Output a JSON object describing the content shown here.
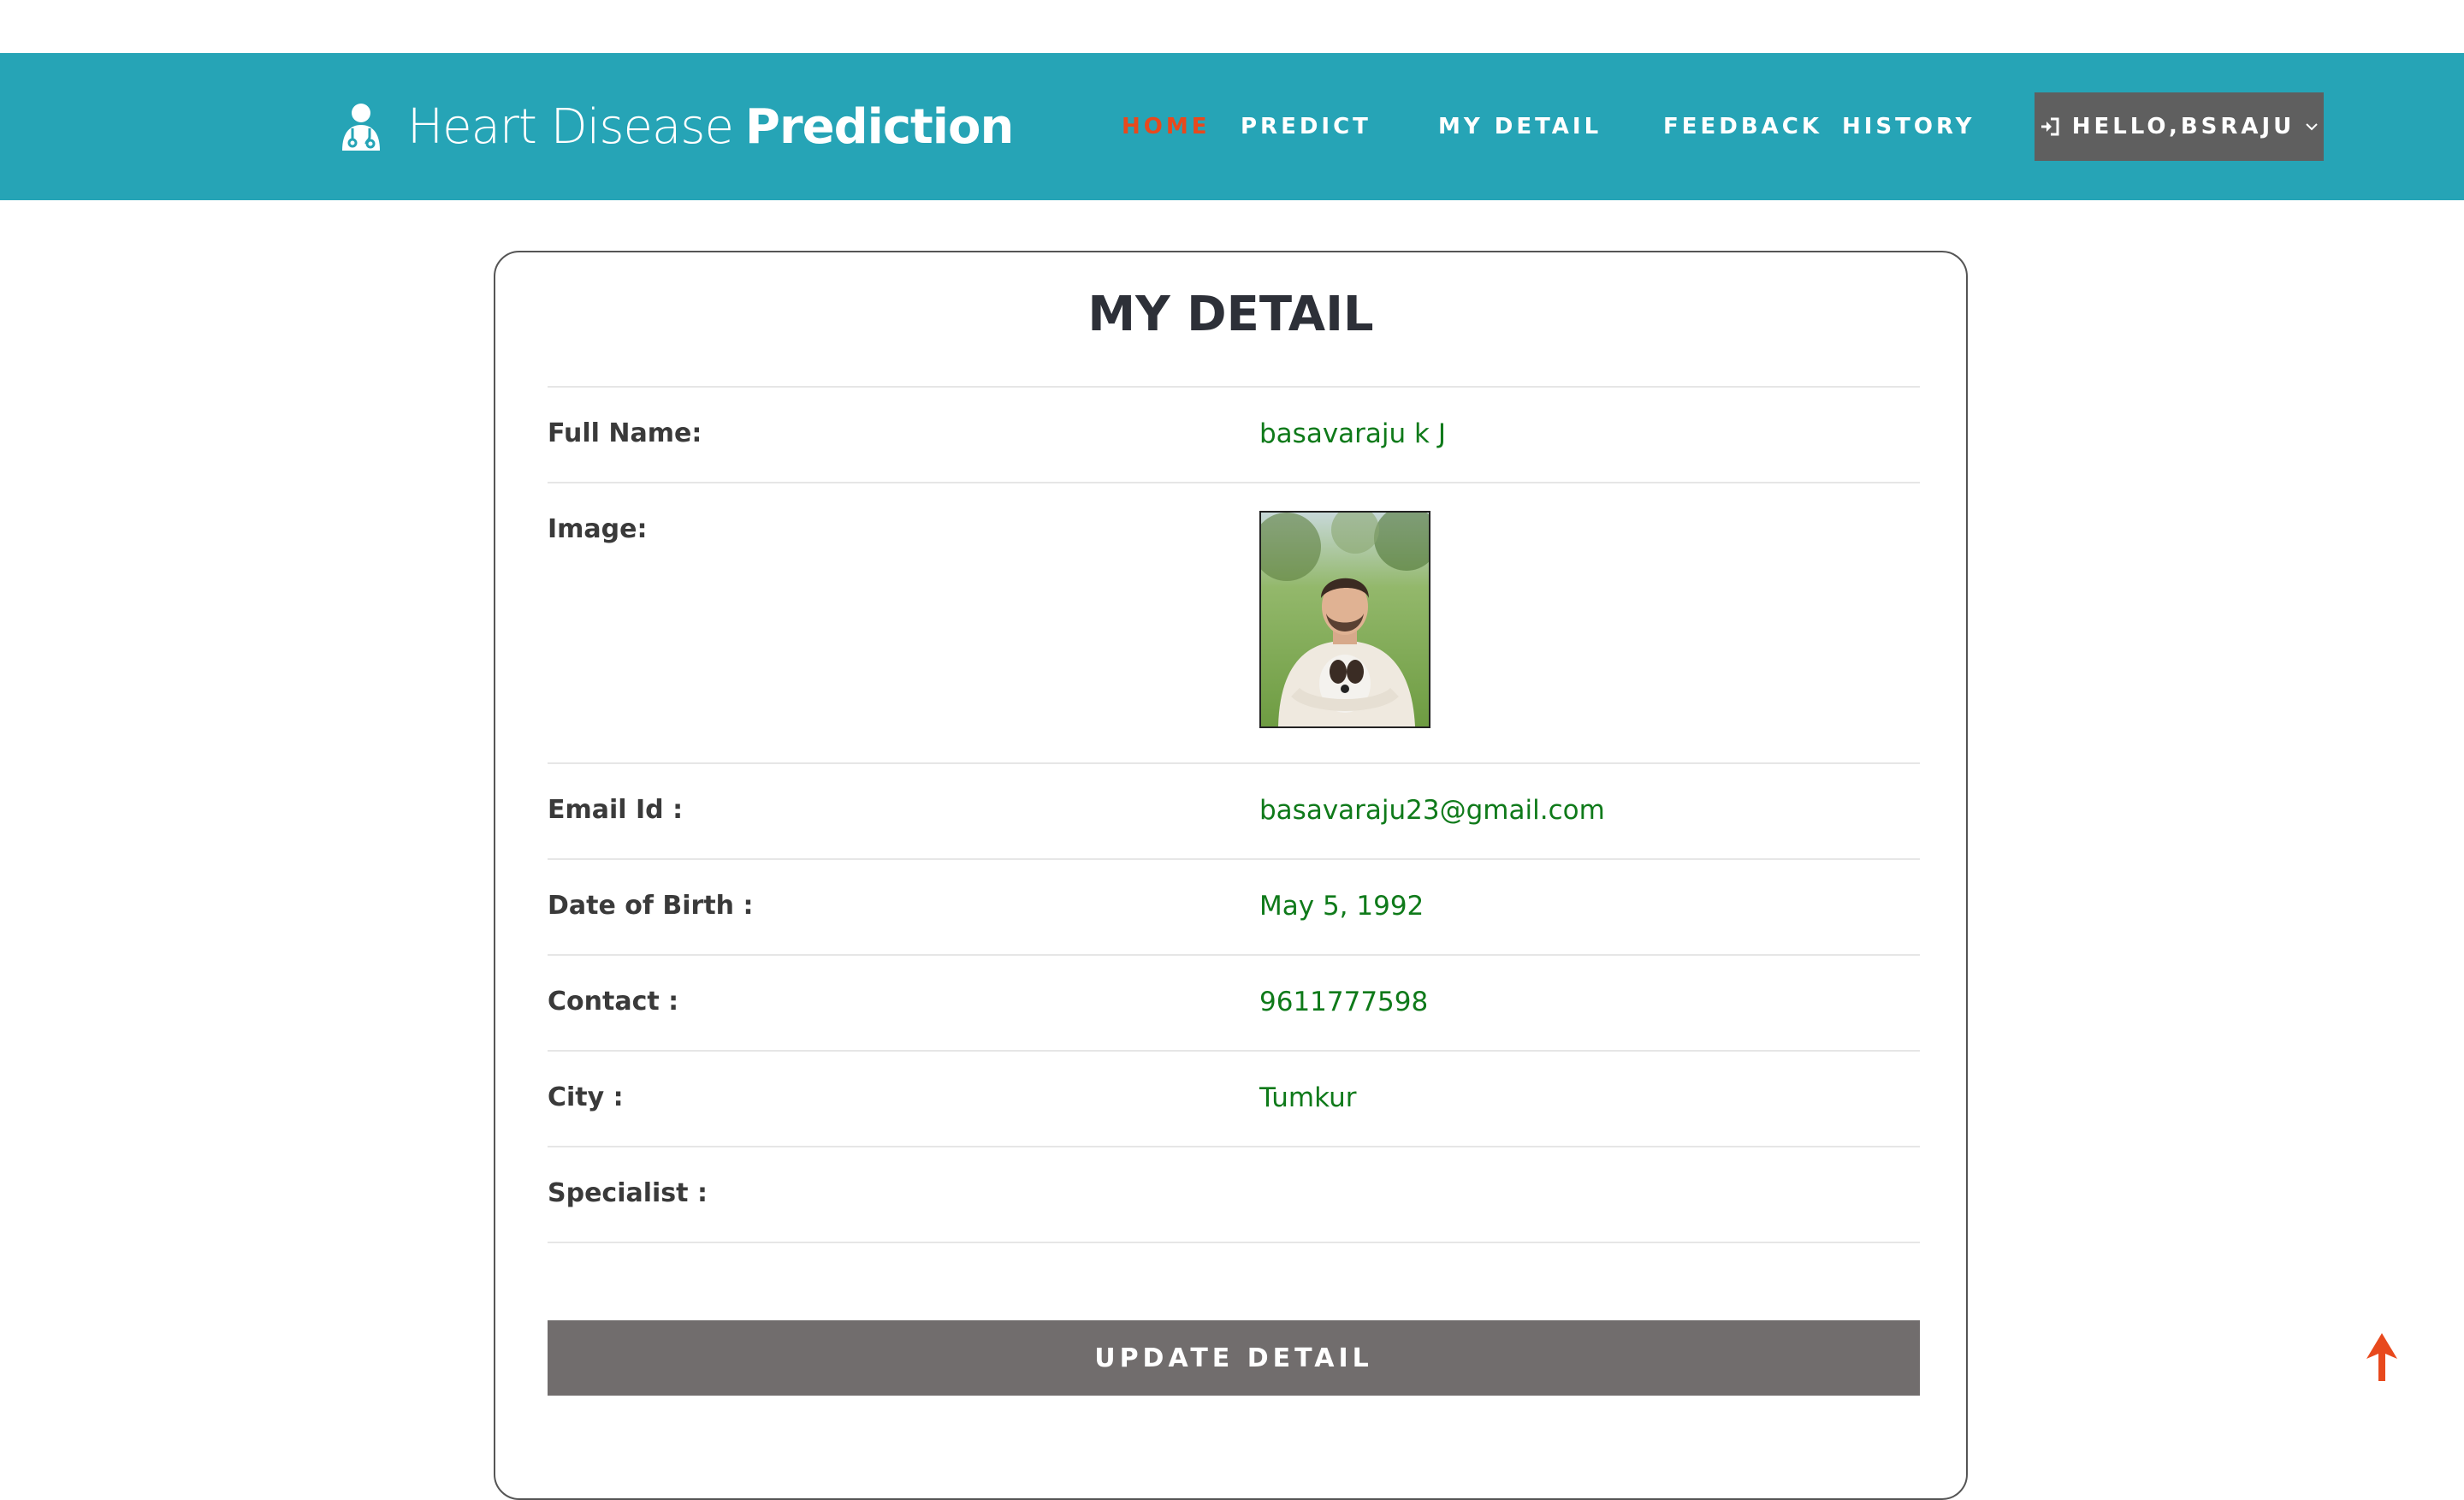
{
  "brand": {
    "light": "Heart Disease",
    "bold": "Prediction",
    "icon": "doctor-icon"
  },
  "nav": {
    "home": "HOME",
    "predict": "PREDICT",
    "my_detail": "MY DETAIL",
    "feedback": "FEEDBACK",
    "history": "HISTORY",
    "user_menu": "HELLO,BSRAJU",
    "user_icon": "sign-in-icon",
    "dropdown_icon": "chevron-down-icon"
  },
  "colors": {
    "navbar": "#26a4b6",
    "active_nav": "#e8491d",
    "value_text": "#0f7a1a",
    "button": "#716d6d",
    "user_menu": "#5f5f5f"
  },
  "detail": {
    "title": "MY DETAIL",
    "rows": [
      {
        "label": "Full Name:",
        "value": "basavaraju k J"
      },
      {
        "label": "Image:",
        "value": ""
      },
      {
        "label": "Email Id :",
        "value": "basavaraju23@gmail.com"
      },
      {
        "label": "Date of Birth :",
        "value": "May 5, 1992"
      },
      {
        "label": "Contact :",
        "value": "9611777598"
      },
      {
        "label": "City :",
        "value": "Tumkur"
      },
      {
        "label": "Specialist :",
        "value": ""
      }
    ],
    "update_button": "UPDATE DETAIL"
  },
  "back_to_top_icon": "arrow-up-icon"
}
